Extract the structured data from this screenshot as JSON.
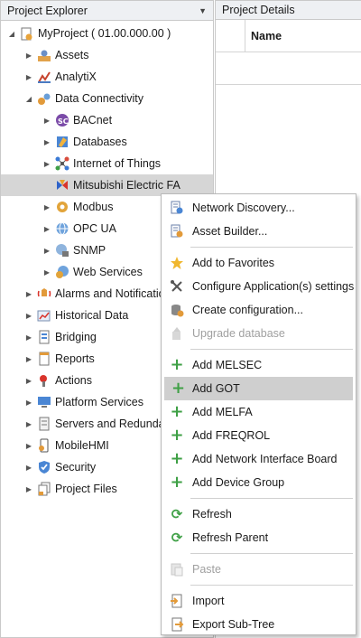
{
  "explorer": {
    "title": "Project Explorer",
    "pin_glyph": "▼"
  },
  "details": {
    "title": "Project Details",
    "column_name": "Name"
  },
  "tree": {
    "root": "MyProject ( 01.00.000.00 )",
    "assets": "Assets",
    "analytix": "AnalytiX",
    "data_connectivity": "Data Connectivity",
    "bacnet": "BACnet",
    "databases": "Databases",
    "iot": "Internet of Things",
    "mitsubishi": "Mitsubishi Electric FA",
    "modbus": "Modbus",
    "opcua": "OPC UA",
    "snmp": "SNMP",
    "web_services": "Web Services",
    "alarms": "Alarms and Notifications",
    "historical": "Historical Data",
    "bridging": "Bridging",
    "reports": "Reports",
    "actions": "Actions",
    "platform": "Platform Services",
    "servers": "Servers and Redundancy",
    "mobilehmi": "MobileHMI",
    "security": "Security",
    "project_files": "Project Files"
  },
  "menu": {
    "network_discovery": "Network Discovery...",
    "asset_builder": "Asset Builder...",
    "add_favorites": "Add to Favorites",
    "configure_app": "Configure Application(s) settings",
    "create_config": "Create configuration...",
    "upgrade_db": "Upgrade database",
    "add_melsec": "Add MELSEC",
    "add_got": "Add GOT",
    "add_melfa": "Add MELFA",
    "add_freqrol": "Add FREQROL",
    "add_nib": "Add Network Interface Board",
    "add_device_group": "Add Device Group",
    "refresh": "Refresh",
    "refresh_parent": "Refresh Parent",
    "paste": "Paste",
    "import": "Import",
    "export": "Export Sub-Tree"
  }
}
